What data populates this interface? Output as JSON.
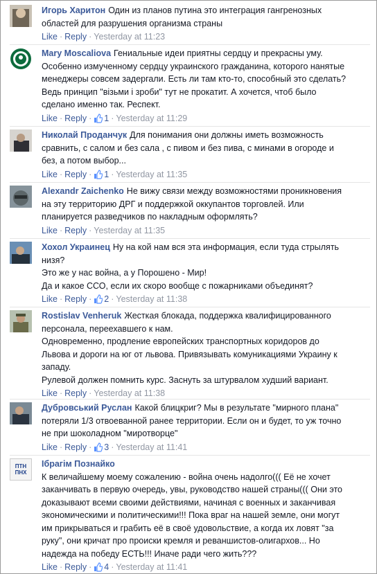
{
  "actions": {
    "like": "Like",
    "reply": "Reply",
    "dot": "·"
  },
  "comments": [
    {
      "author": "Игорь Харитон",
      "lines": [
        "Один из планов путина это интеграция гангренозных",
        "областей для разрушения организма страны"
      ],
      "likes": null,
      "time": "Yesterday at 11:23",
      "avatar": "avatar-igor"
    },
    {
      "author": "Mary Moscaliova",
      "lines": [
        "Гениальные идеи приятны сердцу и прекрасны уму.",
        "Особенно измученному сердцу украинского гражданина, которого нанятые",
        "менеджеры совсем задергали. Есть ли там кто-то, способный это сделать?",
        "Ведь принцип \"візьми і зроби\" тут не прокатит. А хочется, чтоб было",
        "сделано именно так. Респект."
      ],
      "likes": "1",
      "time": "Yesterday at 11:29",
      "avatar": "avatar-mary"
    },
    {
      "author": "Николай Проданчук",
      "lines": [
        "Для понимания они должны иметь возможность",
        "сравнить, с салом и без сала , с пивом и без пива, с минами в огороде и",
        "без, а потом выбор..."
      ],
      "likes": "1",
      "time": "Yesterday at 11:35",
      "avatar": "avatar-nikolay"
    },
    {
      "author": "Alexandr Zaichenko",
      "lines": [
        "Не вижу связи между возможностями проникновения",
        "на эту территорию ДРГ и поддержкой оккупантов торговлей. Или",
        "планируется разведчиков по накладным оформлять?"
      ],
      "likes": null,
      "time": "Yesterday at 11:35",
      "avatar": "avatar-alexandr"
    },
    {
      "author": "Хохол Украинец",
      "lines": [
        "Ну на кой нам вся эта информация, если туда стрылять",
        "низя?",
        "Это же у нас война, а у Порошено - Мир!",
        "Да и какое ССО, если их скоро вообще с пожарниками объединят?"
      ],
      "likes": "2",
      "time": "Yesterday at 11:38",
      "avatar": "avatar-hohol"
    },
    {
      "author": "Rostislav Venheruk",
      "lines": [
        "Жесткая блокада, поддержка квалифицированного",
        "персонала, переехавшего к нам.",
        "Одновременно, продление европейских транспортных коридоров до",
        "Львова и дороги на юг от львова. Привязывать комуникациями Украину к",
        "западу.",
        "Рулевой должен помнить курс. Заснуть за штурвалом худший вариант."
      ],
      "likes": null,
      "time": "Yesterday at 11:38",
      "avatar": "avatar-rostislav"
    },
    {
      "author": "Дубровський Руслан",
      "lines": [
        "Какой блицкриг? Мы в результате \"мирного плана\"",
        "потеряли 1/3 отвоеванной ранее территории. Если он и будет, то уж точно",
        "не при шоколадном \"миротворце\""
      ],
      "likes": "3",
      "time": "Yesterday at 11:41",
      "avatar": "avatar-ruslan"
    },
    {
      "author": "Ібрагім Познайко",
      "lines": [
        "",
        "К величайшему моему сожалению - война очень надолго((( Её не хочет",
        "заканчивать в первую очередь, увы, руководство нашей страны((( Они это",
        "доказывают всеми своими действиями, начиная с военных и заканчивая",
        "экономическими и политическими!!! Пока враг на нашей земле, они могут",
        "им прикрываться и грабить её в своё удовольствие, а когда их ловят \"за",
        "руку\", они кричат про происки кремля и реваншистов-олигархов... Но",
        "надежда на победу ЕСТЬ!!! Иначе ради чего жить???"
      ],
      "likes": "4",
      "time": "Yesterday at 11:41",
      "avatar": "avatar-ibragim",
      "avatar_text": [
        "ПТН",
        "ПНХ"
      ]
    }
  ]
}
